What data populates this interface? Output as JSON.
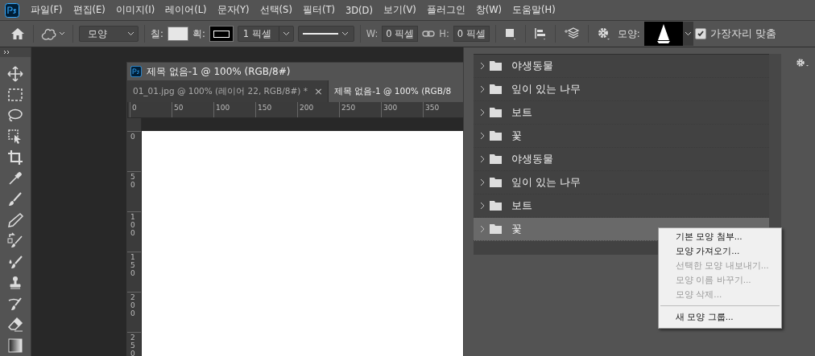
{
  "menu_bar": {
    "items": [
      "파일(F)",
      "편집(E)",
      "이미지(I)",
      "레이어(L)",
      "문자(Y)",
      "선택(S)",
      "필터(T)",
      "3D(D)",
      "보기(V)",
      "플러그인",
      "창(W)",
      "도움말(H)"
    ]
  },
  "options_bar": {
    "tool_mode": "모양",
    "fill_label": "칠:",
    "stroke_label": "획:",
    "stroke_width": "1 픽셀",
    "w_label": "W:",
    "w_value": "0 픽셀",
    "h_label": "H:",
    "h_value": "0 픽셀",
    "shape_label": "모양:",
    "align_edges": {
      "label": "가장자리 맞춤",
      "checked": true
    }
  },
  "document": {
    "title": "제목 없음-1 @ 100% (RGB/8#)",
    "tabs": [
      {
        "label": "01_01.jpg @ 100% (레이어 22, RGB/8#) *",
        "close": "×",
        "selected": false
      },
      {
        "label": "제목 없음-1 @ 100% (RGB/8",
        "selected": true
      }
    ],
    "ruler_h": [
      "0",
      "50",
      "100",
      "150",
      "200",
      "250",
      "300",
      "350"
    ],
    "ruler_v": [
      "0",
      "50",
      "100",
      "150",
      "200",
      "250"
    ]
  },
  "shape_groups": [
    {
      "name": "야생동물",
      "selected": false
    },
    {
      "name": "잎이 있는 나무",
      "selected": false
    },
    {
      "name": "보트",
      "selected": false
    },
    {
      "name": "꽃",
      "selected": false
    },
    {
      "name": "야생동물",
      "selected": false
    },
    {
      "name": "잎이 있는 나무",
      "selected": false
    },
    {
      "name": "보트",
      "selected": false
    },
    {
      "name": "꽃",
      "selected": true
    }
  ],
  "context_menu": [
    {
      "kind": "item",
      "label": "기본 모양 첨부...",
      "disabled": false
    },
    {
      "kind": "item",
      "label": "모양 가져오기...",
      "disabled": false
    },
    {
      "kind": "item",
      "label": "선택한 모양 내보내기...",
      "disabled": true
    },
    {
      "kind": "item",
      "label": "모양 이름 바꾸기...",
      "disabled": true
    },
    {
      "kind": "item",
      "label": "모양 삭제...",
      "disabled": true
    },
    {
      "kind": "separator"
    },
    {
      "kind": "item",
      "label": "새 모양 그룹...",
      "disabled": false
    }
  ]
}
